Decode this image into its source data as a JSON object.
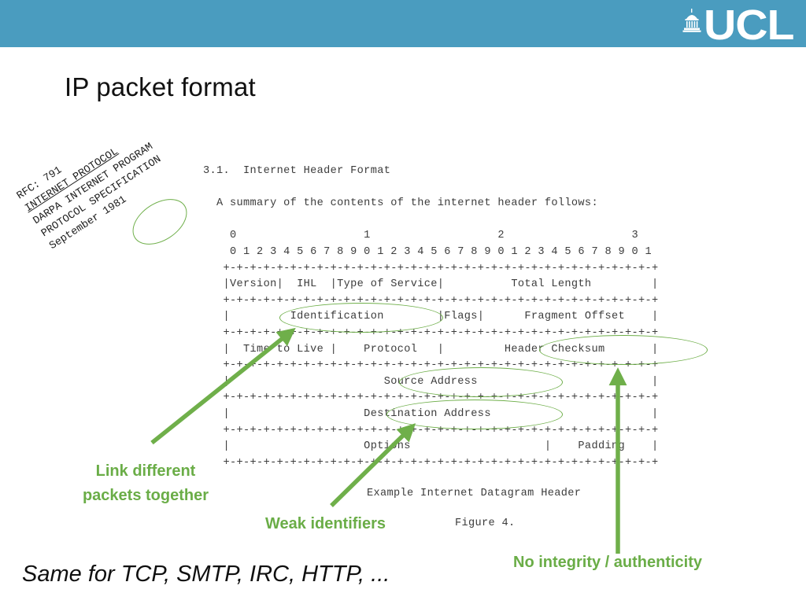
{
  "header": {
    "background_color": "#4A9CBF",
    "logo_text": "UCL",
    "logo_icon": "ucl-dome-icon"
  },
  "slide": {
    "title": "IP packet format",
    "background_color": "#ffffff"
  },
  "rfc_caption": {
    "lines": [
      "RFC: 791",
      "INTERNET PROTOCOL",
      "DARPA INTERNET PROGRAM",
      "PROTOCOL SPECIFICATION",
      "September 1981"
    ],
    "highlighted_token": "1981",
    "rotation_degrees": -33
  },
  "rfc_body": {
    "section_heading": "3.1.  Internet Header Format",
    "intro": "  A summary of the contents of the internet header follows:",
    "bit_ruler_tens": "    0                   1                   2                   3",
    "bit_ruler_units": "    0 1 2 3 4 5 6 7 8 9 0 1 2 3 4 5 6 7 8 9 0 1 2 3 4 5 6 7 8 9 0 1",
    "rows": [
      "   +-+-+-+-+-+-+-+-+-+-+-+-+-+-+-+-+-+-+-+-+-+-+-+-+-+-+-+-+-+-+-+-+",
      "   |Version|  IHL  |Type of Service|          Total Length         |",
      "   +-+-+-+-+-+-+-+-+-+-+-+-+-+-+-+-+-+-+-+-+-+-+-+-+-+-+-+-+-+-+-+-+",
      "   |         Identification        |Flags|      Fragment Offset    |",
      "   +-+-+-+-+-+-+-+-+-+-+-+-+-+-+-+-+-+-+-+-+-+-+-+-+-+-+-+-+-+-+-+-+",
      "   |  Time to Live |    Protocol   |         Header Checksum       |",
      "   +-+-+-+-+-+-+-+-+-+-+-+-+-+-+-+-+-+-+-+-+-+-+-+-+-+-+-+-+-+-+-+-+",
      "   |                       Source Address                          |",
      "   +-+-+-+-+-+-+-+-+-+-+-+-+-+-+-+-+-+-+-+-+-+-+-+-+-+-+-+-+-+-+-+-+",
      "   |                    Destination Address                        |",
      "   +-+-+-+-+-+-+-+-+-+-+-+-+-+-+-+-+-+-+-+-+-+-+-+-+-+-+-+-+-+-+-+-+",
      "   |                    Options                    |    Padding    |",
      "   +-+-+-+-+-+-+-+-+-+-+-+-+-+-+-+-+-+-+-+-+-+-+-+-+-+-+-+-+-+-+-+-+"
    ],
    "figure_caption": "Example Internet Datagram Header",
    "figure_number": "Figure 4."
  },
  "highlights": {
    "accent_color": "#6FAF4A",
    "circled_fields": [
      "Identification",
      "Header Checksum",
      "Source Address",
      "Destination Address"
    ]
  },
  "annotations": {
    "color": "#6AAD47",
    "link_packets": "Link different\npackets together",
    "link_packets_line1": "Link different",
    "link_packets_line2": "packets together",
    "weak_identifiers": "Weak identifiers",
    "no_integrity": "No integrity / authenticity"
  },
  "bottom_note": {
    "text": "Same for TCP, SMTP, IRC, HTTP, ..."
  }
}
